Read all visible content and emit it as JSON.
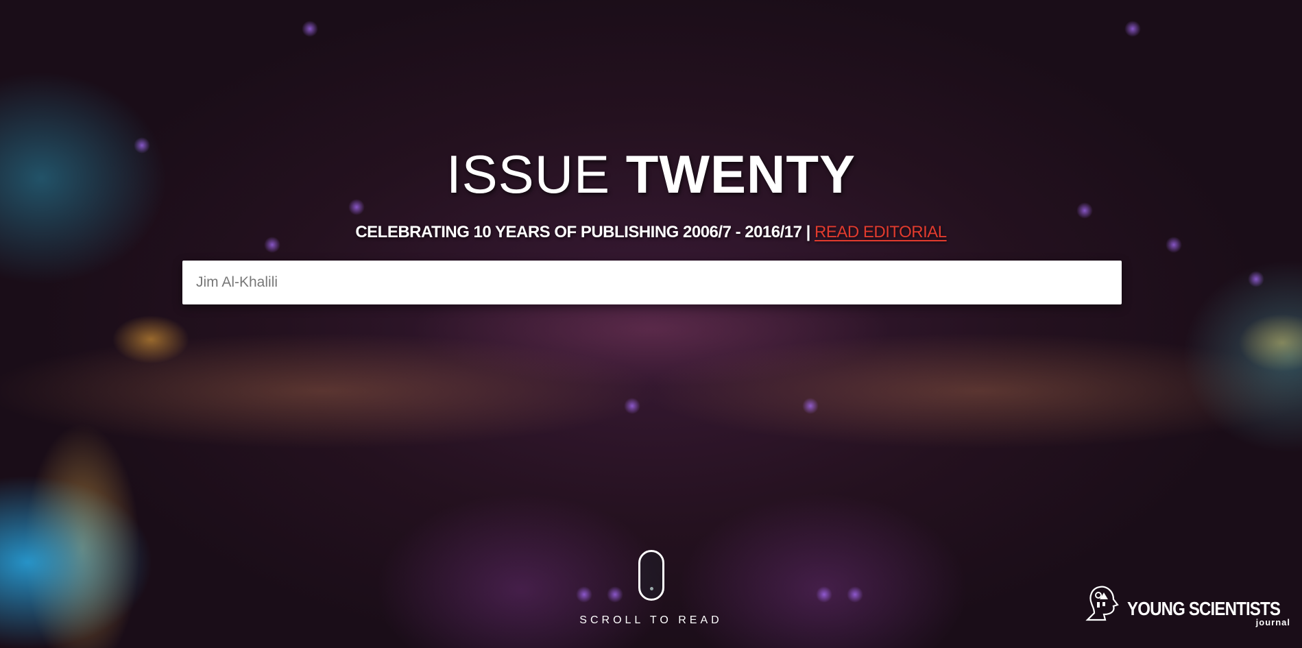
{
  "hero": {
    "title_light": "ISSUE",
    "title_bold": "TWENTY",
    "subtitle_text": "CELEBRATING 10 YEARS OF PUBLISHING 2006/7 - 2016/17 |",
    "subtitle_link": "READ EDITORIAL"
  },
  "search": {
    "placeholder": "Jim Al-Khalili",
    "value": ""
  },
  "scroll": {
    "label": "SCROLL TO READ"
  },
  "logo": {
    "name": "YOUNG SCIENTISTS",
    "sub": "journal"
  },
  "icons": {
    "scroll": "mouse-scroll-icon",
    "logo": "young-scientists-head-logo"
  },
  "colors": {
    "accent_link": "#e23b2e",
    "text": "#ffffff",
    "background": "#24111f"
  }
}
